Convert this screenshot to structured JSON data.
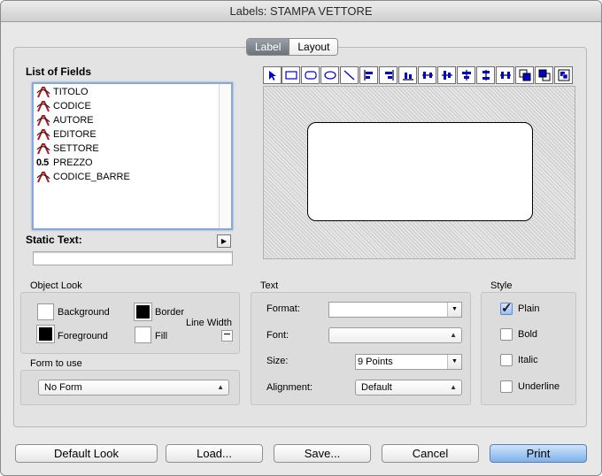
{
  "window": {
    "title": "Labels: STAMPA  VETTORE"
  },
  "tabs": [
    {
      "label": "Label",
      "active": true
    },
    {
      "label": "Layout",
      "active": false
    }
  ],
  "fields": {
    "title": "List of Fields",
    "items": [
      {
        "label": "TITOLO",
        "icon": "text-field-icon"
      },
      {
        "label": "CODICE",
        "icon": "text-field-icon"
      },
      {
        "label": "AUTORE",
        "icon": "text-field-icon"
      },
      {
        "label": "EDITORE",
        "icon": "text-field-icon"
      },
      {
        "label": "SETTORE",
        "icon": "text-field-icon"
      },
      {
        "label": "PREZZO",
        "icon": "numeric-field-icon",
        "prefix": "0.5"
      },
      {
        "label": "CODICE_BARRE",
        "icon": "text-field-icon"
      }
    ]
  },
  "static_text": {
    "label": "Static Text:",
    "value": ""
  },
  "object_look": {
    "title": "Object Look",
    "background": "Background",
    "border": "Border",
    "line_width": "Line Width",
    "foreground": "Foreground",
    "fill": "Fill"
  },
  "form_to_use": {
    "title": "Form to use",
    "value": "No Form"
  },
  "text": {
    "title": "Text",
    "format_label": "Format:",
    "format_value": "",
    "font_label": "Font:",
    "font_value": "",
    "size_label": "Size:",
    "size_value": "9 Points",
    "alignment_label": "Alignment:",
    "alignment_value": "Default"
  },
  "style": {
    "title": "Style",
    "plain": "Plain",
    "bold": "Bold",
    "italic": "Italic",
    "underline": "Underline",
    "plain_checked": true
  },
  "buttons": {
    "default_look": "Default Look",
    "load": "Load...",
    "save": "Save...",
    "cancel": "Cancel",
    "print": "Print"
  },
  "colors": {
    "accent": "#7fb2ec",
    "field_icon": "#b01818"
  }
}
